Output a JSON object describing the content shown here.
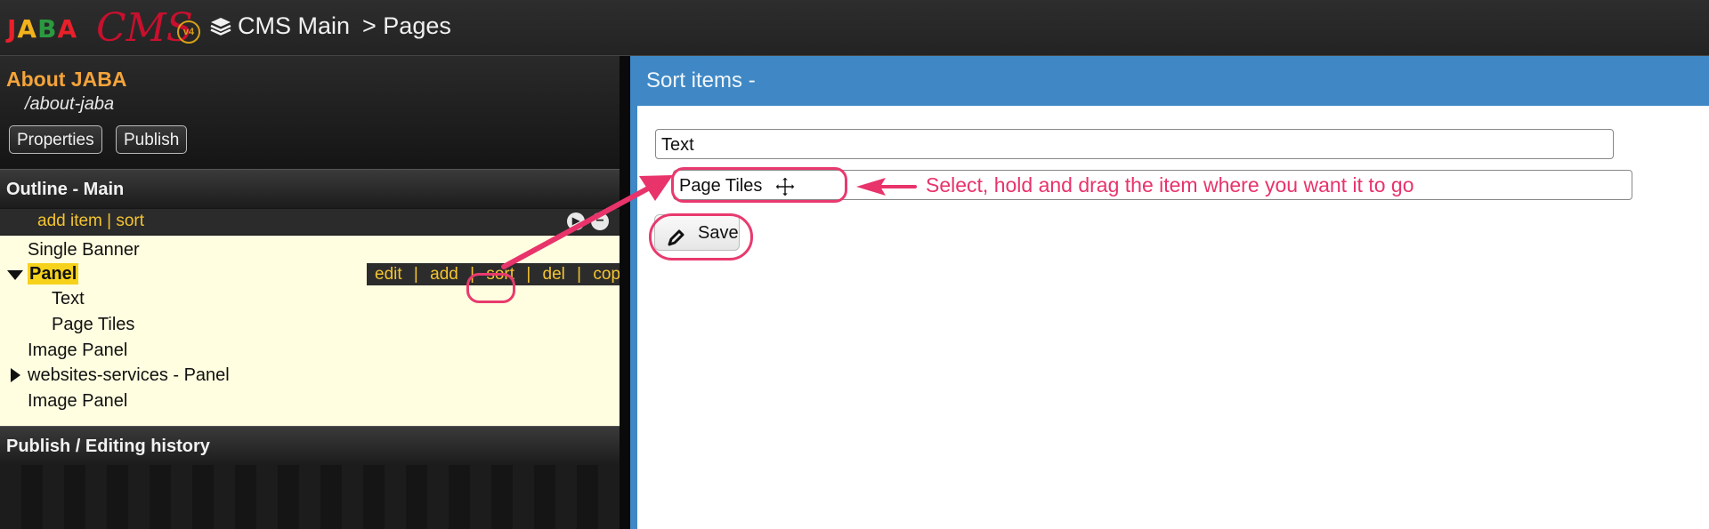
{
  "header": {
    "logo_text": [
      "J",
      "A",
      "B",
      "A"
    ],
    "logo_colors": [
      "#e8202a",
      "#f2b21b",
      "#2b9a3f",
      "#e8202a"
    ],
    "logo_cms": "CMS",
    "logo_version": "v4",
    "breadcrumb": [
      "CMS Main",
      "> Pages"
    ]
  },
  "page": {
    "title": "About JABA",
    "path": "/about-jaba",
    "buttons": [
      "Properties",
      "Publish"
    ]
  },
  "outline": {
    "heading": "Outline - Main",
    "links": "add item | sort",
    "items": [
      {
        "label": "Single Banner"
      },
      {
        "label": "Panel",
        "selected": true,
        "expanded": true
      },
      {
        "label": "Text"
      },
      {
        "label": "Page Tiles"
      },
      {
        "label": "Image Panel"
      },
      {
        "label": "websites-services - Panel",
        "collapsed": true
      },
      {
        "label": "Image Panel"
      }
    ],
    "actions": [
      "edit",
      "add",
      "sort",
      "del",
      "copy"
    ],
    "action_sep": "|"
  },
  "history": {
    "heading": "Publish / Editing history"
  },
  "sort_panel": {
    "title": "Sort items -",
    "items": [
      "Text",
      "Page Tiles"
    ],
    "save_label": "Save"
  },
  "annotation": {
    "text": "Select, hold and drag the item where you want it to go",
    "color": "#e8336b"
  }
}
